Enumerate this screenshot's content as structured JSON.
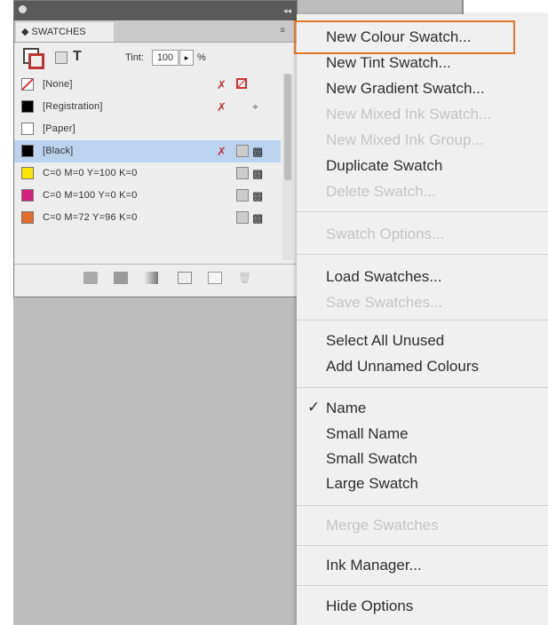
{
  "panel": {
    "tab_title": "◆ SWATCHES",
    "tint_label": "Tint:",
    "tint_value": "100",
    "tint_unit": "%",
    "swatches": [
      {
        "name": "[None]",
        "color": "#ffffff"
      },
      {
        "name": "[Registration]",
        "color": "#000000"
      },
      {
        "name": "[Paper]",
        "color": "#ffffff"
      },
      {
        "name": "[Black]",
        "color": "#000000",
        "selected": true
      },
      {
        "name": "C=0 M=0 Y=100 K=0",
        "color": "#ffe600"
      },
      {
        "name": "C=0 M=100 Y=0 K=0",
        "color": "#d4217f"
      },
      {
        "name": "C=0 M=72 Y=96 K=0",
        "color": "#e16c2b"
      }
    ]
  },
  "menu": {
    "new_colour_swatch": "New Colour Swatch...",
    "new_tint_swatch": "New Tint Swatch...",
    "new_gradient_swatch": "New Gradient Swatch...",
    "new_mixed_ink_swatch": "New Mixed Ink Swatch...",
    "new_mixed_ink_group": "New Mixed Ink Group...",
    "duplicate_swatch": "Duplicate Swatch",
    "delete_swatch": "Delete Swatch...",
    "swatch_options": "Swatch Options...",
    "load_swatches": "Load Swatches...",
    "save_swatches": "Save Swatches...",
    "select_all_unused": "Select All Unused",
    "add_unnamed_colours": "Add Unnamed Colours",
    "check_mark": "✓",
    "name": "Name",
    "small_name": "Small Name",
    "small_swatch": "Small Swatch",
    "large_swatch": "Large Swatch",
    "merge_swatches": "Merge Swatches",
    "ink_manager": "Ink Manager...",
    "hide_options": "Hide Options"
  },
  "colors": {
    "highlight": "#e37528",
    "selection": "#bcd3f0"
  }
}
